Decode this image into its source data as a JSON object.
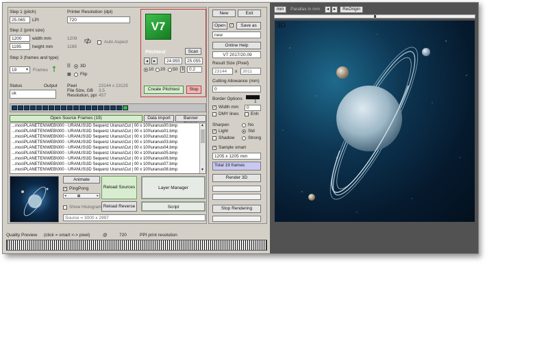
{
  "left": {
    "step1_label": "Step 1 (pitch)",
    "pitch_value": "25.065",
    "pitch_unit": "LPI",
    "printer_res_label": "Printer Resolution (dpi)",
    "printer_res_value": "720",
    "step2_label": "Step 2 (print size)",
    "width_value": "1200",
    "width_unit": "width mm",
    "width_px": "1209",
    "height_value": "1195",
    "height_unit": "height mm",
    "height_px": "1189",
    "auto_aspect_label": "Auto Aspect",
    "step3_label": "Step 3 (frames and type)",
    "frames_value": "19",
    "frames_label": "Frames",
    "type_3d_label": "3D",
    "type_flip_label": "Flip",
    "status_label": "Status",
    "output_label": "Output",
    "status_value": "ok",
    "pixel_label": "Pixel",
    "pixel_value": "23144 x 23125",
    "filesize_label": "File Size, GB",
    "filesize_value": "3.5",
    "resolution_label": "Resolution, ppi",
    "resolution_value": "457",
    "logo_text": "V7",
    "pitchtest_label": "Pitchtest",
    "scan_label": "Scan",
    "pt_value1": "24.955",
    "pt_value2": "25.055",
    "pt_opt1": "10",
    "pt_opt2": "20",
    "pt_opt3": "50",
    "pt_step": "0.2",
    "create_pitchtest_label": "Create Pitchtest",
    "stop_label": "Stop",
    "open_frames_label": "Open Source Frames (19)",
    "data_import_label": "Data import",
    "banner_screen_label": "Banner Screen",
    "frame_rows": [
      "...mos\\PLANETEN\\WEB\\000 - URANUS\\3D Sequenz Uranus\\Cut | 00 x 100\\uranus00.bmp",
      "...mos\\PLANETEN\\WEB\\000 - URANUS\\3D Sequenz Uranus\\Cut | 00 x 100\\uranus01.bmp",
      "...mos\\PLANETEN\\WEB\\000 - URANUS\\3D Sequenz Uranus\\Cut | 00 x 100\\uranus02.bmp",
      "...mos\\PLANETEN\\WEB\\000 - URANUS\\3D Sequenz Uranus\\Cut | 00 x 100\\uranus03.bmp",
      "...mos\\PLANETEN\\WEB\\000 - URANUS\\3D Sequenz Uranus\\Cut | 00 x 100\\uranus04.bmp",
      "...mos\\PLANETEN\\WEB\\000 - URANUS\\3D Sequenz Uranus\\Cut | 00 x 100\\uranus05.bmp",
      "...mos\\PLANETEN\\WEB\\000 - URANUS\\3D Sequenz Uranus\\Cut | 00 x 100\\uranus06.bmp",
      "...mos\\PLANETEN\\WEB\\000 - URANUS\\3D Sequenz Uranus\\Cut | 00 x 100\\uranus07.bmp",
      "...mos\\PLANETEN\\WEB\\000 - URANUS\\3D Sequenz Uranus\\Cut | 00 x 100\\uranus08.bmp"
    ],
    "animate_label": "Animate",
    "pingpong_label": "PingPong",
    "show_histogram_label": "Show Histogram",
    "reload_sources_label": "Reload Sources",
    "reload_reverse_label": "Reload Reverse",
    "layer_manager_label": "Layer Manager",
    "script_label": "Script",
    "source_info": "Source = 3000 x 2997",
    "quality_preview_label": "Quality Preview",
    "click_label": "(click = smart <-> pixel)",
    "at_label": "@",
    "quality_dpi": "720",
    "ppi_label": "PPI print resolution"
  },
  "middle": {
    "new_label": "New",
    "exit_label": "Exit",
    "open_label": "Open",
    "save_as_label": "Save as",
    "filename_value": "new",
    "online_help_label": "Online Help",
    "version_value": "V7 2017/20.09",
    "result_size_label": "Result Size (Pixel)",
    "result_w": "23144",
    "result_x": "x",
    "result_h": "3011",
    "cutting_label": "Cutting Allowance (mm)",
    "cutting_value": "0",
    "border_label": "Border Options",
    "border_value": "1",
    "width_mm_label": "Width mm",
    "border_width": "0",
    "dmy_lines_label": "DMY lines",
    "enh_label": "Enh",
    "sharpen_label": "Sharpen",
    "no_label": "No",
    "light_label": "Light",
    "std_label": "Std",
    "shadow_label": "Shadow",
    "strong_label": "Strong",
    "sample_smart_label": "Sample smart",
    "size_mm_value": "1205 x 1205 mm",
    "total_frames_value": "Total 19 frames",
    "render_label": "Render 3D",
    "stop_rendering_label": "Stop Rendering"
  },
  "right": {
    "unit_label": "mm",
    "parallax_label": "Parallax in mm",
    "reorigin_label": "ReOrigin",
    "view_label": "3D"
  }
}
